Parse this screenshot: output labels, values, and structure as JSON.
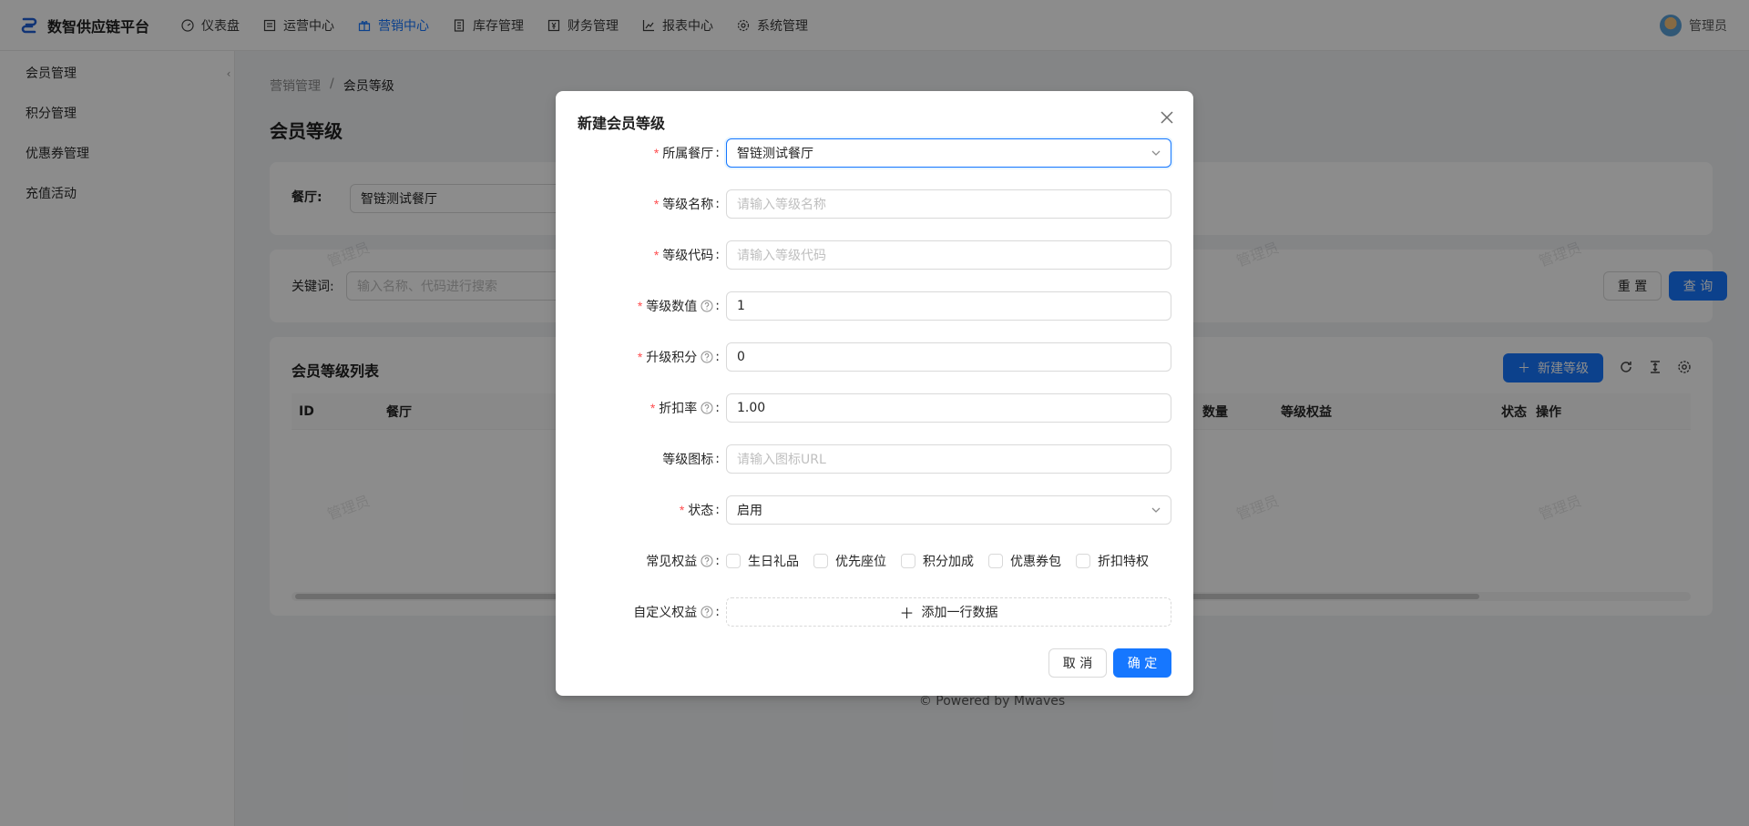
{
  "app": {
    "name": "数智供应链平台",
    "brand_color": "#1677ff"
  },
  "topnav": [
    {
      "label": "仪表盘",
      "icon": "dashboard-icon",
      "active": false
    },
    {
      "label": "运营中心",
      "icon": "operations-icon",
      "active": false
    },
    {
      "label": "营销中心",
      "icon": "gift-icon",
      "active": true
    },
    {
      "label": "库存管理",
      "icon": "inventory-icon",
      "active": false
    },
    {
      "label": "财务管理",
      "icon": "finance-icon",
      "active": false
    },
    {
      "label": "报表中心",
      "icon": "chart-icon",
      "active": false
    },
    {
      "label": "系统管理",
      "icon": "settings-icon",
      "active": false
    }
  ],
  "user": {
    "name": "管理员"
  },
  "sidebar": {
    "items": [
      {
        "label": "会员管理"
      },
      {
        "label": "积分管理"
      },
      {
        "label": "优惠券管理"
      },
      {
        "label": "充值活动"
      }
    ]
  },
  "breadcrumb": {
    "parent": "营销管理",
    "separator": "/",
    "current": "会员等级"
  },
  "page": {
    "title": "会员等级"
  },
  "filters": {
    "restaurant_label": "餐厅:",
    "restaurant_value": "智链测试餐厅",
    "keyword_label": "关键词:",
    "keyword_placeholder": "输入名称、代码进行搜索",
    "reset_label": "重 置",
    "search_label": "查 询"
  },
  "list": {
    "title": "会员等级列表",
    "new_button": "新建等级",
    "columns": [
      "ID",
      "餐厅",
      "数量",
      "等级权益",
      "状态",
      "操作"
    ]
  },
  "footer": {
    "text": "Powered by Mwaves"
  },
  "watermark": "管理员",
  "modal": {
    "title": "新建会员等级",
    "fields": {
      "restaurant": {
        "label": "所属餐厅",
        "value": "智链测试餐厅",
        "required": true
      },
      "level_name": {
        "label": "等级名称",
        "placeholder": "请输入等级名称",
        "required": true
      },
      "level_code": {
        "label": "等级代码",
        "placeholder": "请输入等级代码",
        "required": true
      },
      "level_value": {
        "label": "等级数值",
        "value": "1",
        "required": true
      },
      "upgrade_points": {
        "label": "升级积分",
        "value": "0",
        "required": true
      },
      "discount_rate": {
        "label": "折扣率",
        "value": "1.00",
        "required": true
      },
      "level_icon": {
        "label": "等级图标",
        "placeholder": "请输入图标URL",
        "required": false
      },
      "status": {
        "label": "状态",
        "value": "启用",
        "required": true
      },
      "common_benefits": {
        "label": "常见权益",
        "options": [
          "生日礼品",
          "优先座位",
          "积分加成",
          "优惠券包",
          "折扣特权"
        ]
      },
      "custom_benefits": {
        "label": "自定义权益",
        "add_label": "添加一行数据"
      }
    },
    "cancel_label": "取 消",
    "ok_label": "确 定"
  }
}
